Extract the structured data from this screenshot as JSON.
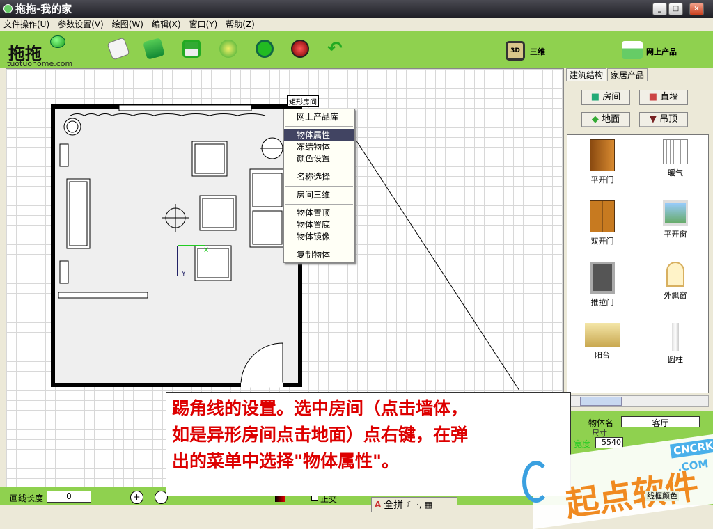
{
  "window": {
    "title": "拖拖-我的家",
    "controls": [
      "_",
      "□",
      "×"
    ]
  },
  "menu": [
    "文件操作(U)",
    "参数设置(V)",
    "绘图(W)",
    "编辑(X)",
    "窗口(Y)",
    "帮助(Z)"
  ],
  "toolbar": {
    "logo_text": "tuotuohome.com",
    "logo_han": "拖拖",
    "three_d_badge": "3D",
    "three_d_label": "三维",
    "online_label": "网上产品"
  },
  "canvas": {
    "room_label": "矩形房间",
    "axis_x": "X",
    "axis_y": "Y"
  },
  "context_menu": {
    "items": [
      "网上产品库",
      "物体属性",
      "冻结物体",
      "颜色设置",
      "名称选择",
      "房间三维",
      "物体置顶",
      "物体置底",
      "物体镜像",
      "复制物体"
    ],
    "selected": "物体属性"
  },
  "right_panel": {
    "tabs": [
      "建筑结构",
      "家居产品"
    ],
    "buttons": [
      "房间",
      "直墙",
      "地面",
      "吊顶"
    ],
    "products": [
      "平开门",
      "暖气",
      "双开门",
      "平开窗",
      "推拉门",
      "外飘窗",
      "阳台",
      "圆柱"
    ],
    "props": {
      "name_label": "物体名",
      "name_value": "客厅",
      "size_legend": "尺寸",
      "width_label": "宽度",
      "width_value": "5540",
      "frame_color_label": "线框颜色"
    }
  },
  "bottom": {
    "line_length_label": "画线长度",
    "line_length_value": "0",
    "ortho_label": "正交",
    "ime_label": "全拼"
  },
  "annotation": {
    "lines": [
      "踢角线的设置。选中房间（点击墙体，",
      "如是异形房间点击地面）点右键，在弹",
      "出的菜单中选择\"物体属性\"。"
    ]
  },
  "watermark": {
    "brand": "起点软件",
    "badge": "CNCRK",
    ".com": ".COM"
  }
}
